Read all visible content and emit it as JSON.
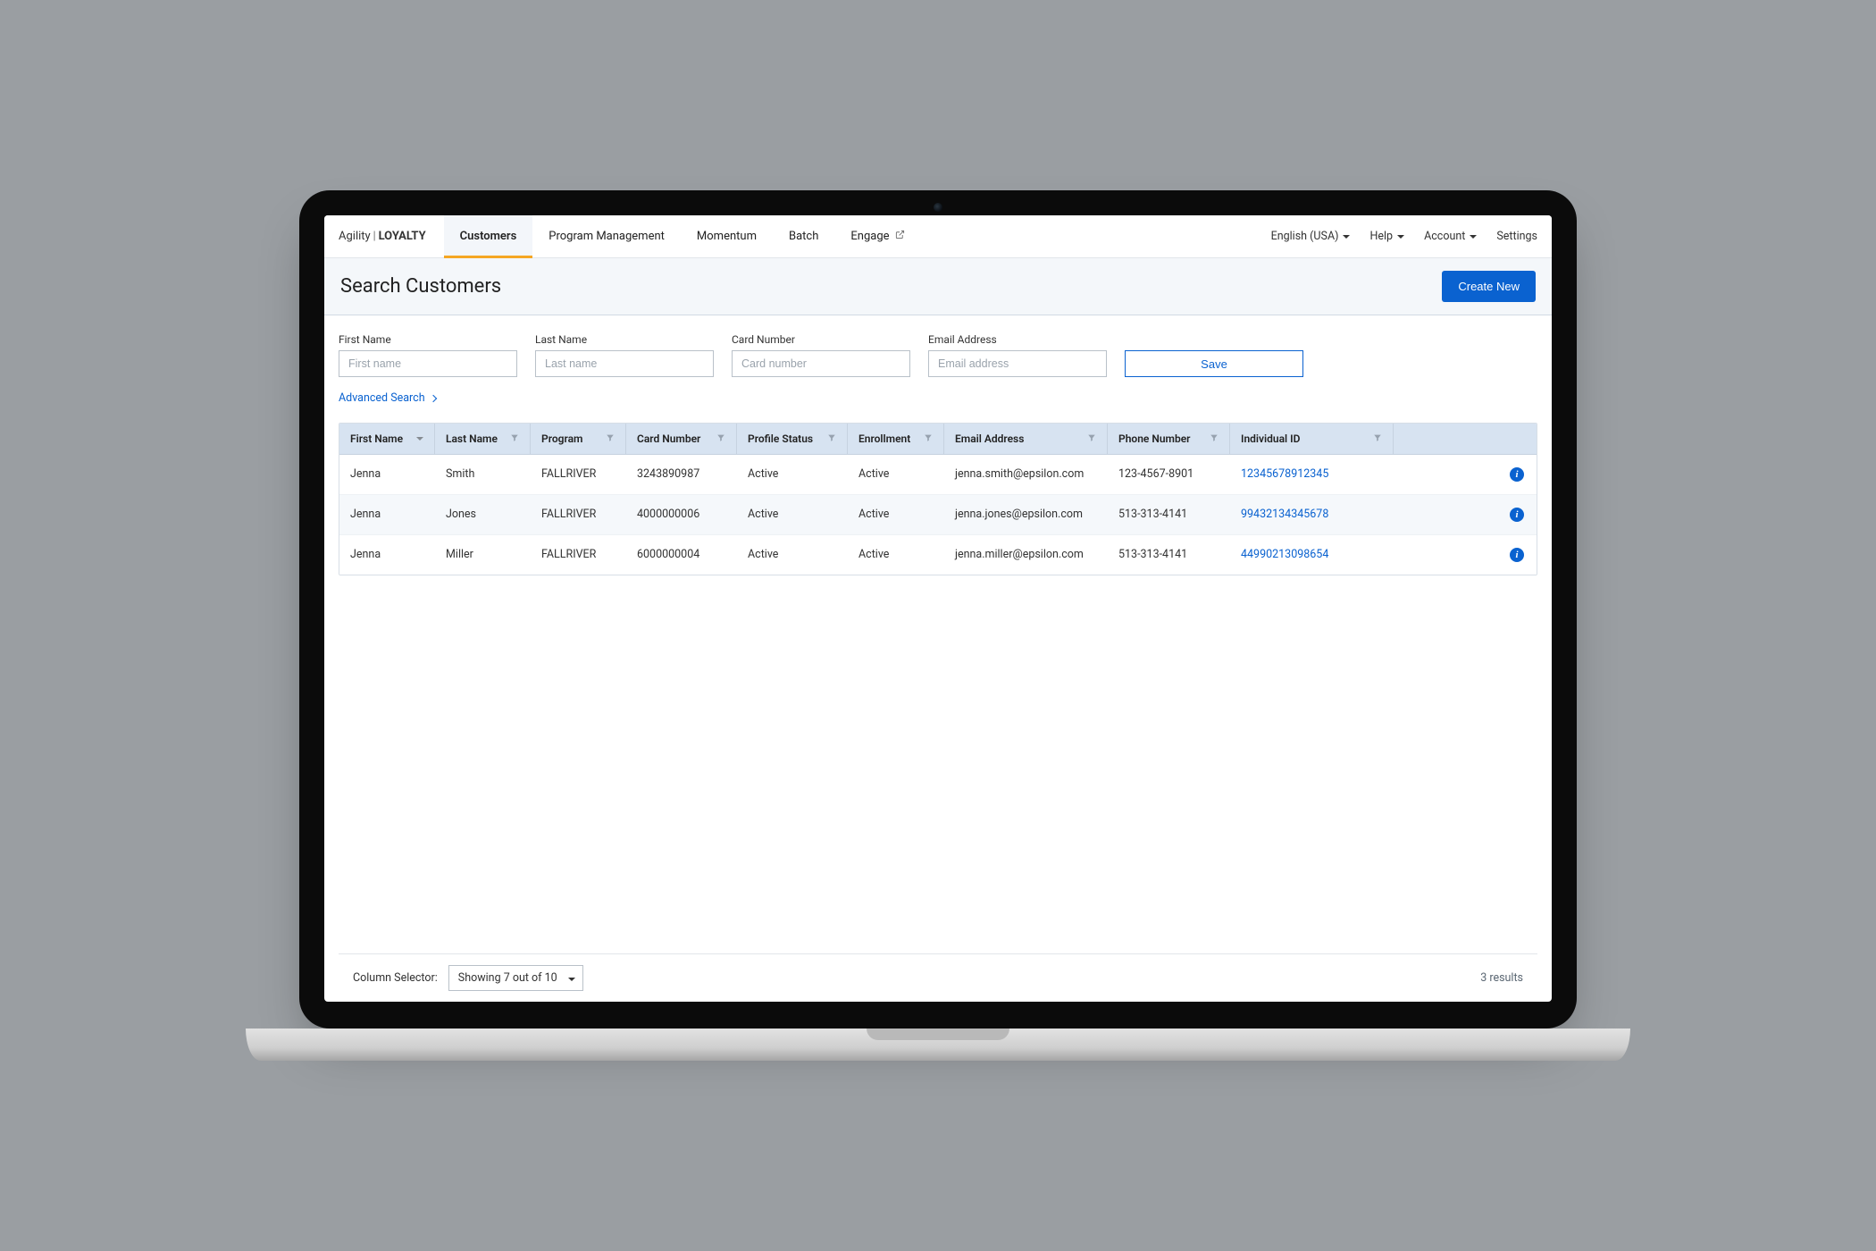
{
  "brand": {
    "left": "Agility",
    "right": "LOYALTY"
  },
  "nav": {
    "tabs": [
      {
        "label": "Customers",
        "active": true
      },
      {
        "label": "Program Management"
      },
      {
        "label": "Momentum"
      },
      {
        "label": "Batch"
      },
      {
        "label": "Engage",
        "external": true
      }
    ],
    "right": {
      "language": "English (USA)",
      "help": "Help",
      "account": "Account",
      "settings": "Settings"
    }
  },
  "page": {
    "title": "Search Customers",
    "create_button": "Create New"
  },
  "search": {
    "fields": {
      "first_name": {
        "label": "First Name",
        "placeholder": "First name"
      },
      "last_name": {
        "label": "Last Name",
        "placeholder": "Last name"
      },
      "card_number": {
        "label": "Card Number",
        "placeholder": "Card number"
      },
      "email": {
        "label": "Email Address",
        "placeholder": "Email address"
      }
    },
    "save_button": "Save",
    "advanced_link": "Advanced Search"
  },
  "table": {
    "columns": [
      "First Name",
      "Last Name",
      "Program",
      "Card Number",
      "Profile Status",
      "Enrollment",
      "Email Address",
      "Phone Number",
      "Individual ID"
    ],
    "rows": [
      {
        "first": "Jenna",
        "last": "Smith",
        "program": "FALLRIVER",
        "card": "3243890987",
        "profile": "Active",
        "enroll": "Active",
        "email": "jenna.smith@epsilon.com",
        "phone": "123-4567-8901",
        "id": "12345678912345"
      },
      {
        "first": "Jenna",
        "last": "Jones",
        "program": "FALLRIVER",
        "card": "4000000006",
        "profile": "Active",
        "enroll": "Active",
        "email": "jenna.jones@epsilon.com",
        "phone": "513-313-4141",
        "id": "99432134345678"
      },
      {
        "first": "Jenna",
        "last": "Miller",
        "program": "FALLRIVER",
        "card": "6000000004",
        "profile": "Active",
        "enroll": "Active",
        "email": "jenna.miller@epsilon.com",
        "phone": "513-313-4141",
        "id": "44990213098654"
      }
    ]
  },
  "footer": {
    "column_selector_label": "Column Selector:",
    "column_selector_value": "Showing 7 out of 10",
    "result_count": "3 results"
  }
}
